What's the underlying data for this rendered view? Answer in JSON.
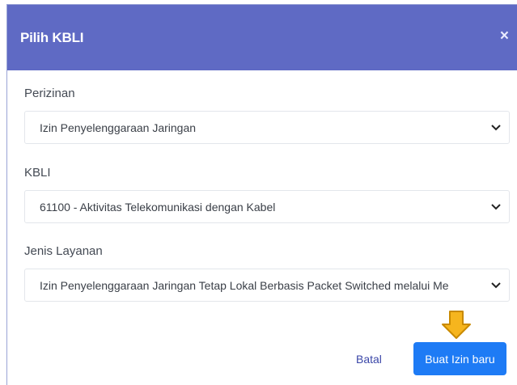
{
  "modal": {
    "title": "Pilih KBLI",
    "close_icon": "close-icon",
    "close_glyph": "×"
  },
  "fields": {
    "perizinan": {
      "label": "Perizinan",
      "value": "Izin Penyelenggaraan Jaringan"
    },
    "kbli": {
      "label": "KBLI",
      "value": "61100 - Aktivitas Telekomunikasi dengan Kabel"
    },
    "jenis_layanan": {
      "label": "Jenis Layanan",
      "value": "Izin Penyelenggaraan Jaringan Tetap Lokal Berbasis Packet Switched melalui Me"
    }
  },
  "footer": {
    "cancel_label": "Batal",
    "submit_label": "Buat Izin baru"
  },
  "colors": {
    "header": "#5f6ac4",
    "primary": "#1e7bf5",
    "pointer_arrow": "#f6b51e"
  },
  "icons": {
    "dropdown": "chevron-down-icon",
    "pointer": "arrow-down-icon"
  }
}
